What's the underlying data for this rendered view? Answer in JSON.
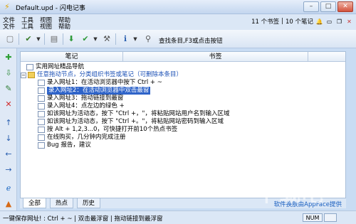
{
  "window": {
    "title": "Default.upd - 闪电记事",
    "minimize": "–",
    "maximize": "□",
    "close": "✕"
  },
  "menu": {
    "row1": [
      "文件",
      "工具",
      "视图",
      "帮助"
    ],
    "row2": [
      "文件",
      "工具",
      "视图",
      "帮助"
    ],
    "bookmark_count": "11 个书签",
    "hotspot_label": "10 个笔记"
  },
  "toolbar": {
    "hint": "查找条目,F3或点击按钮"
  },
  "columns": {
    "notes": "笔记",
    "bookmarks": "书签"
  },
  "tree": {
    "item1": "实用网址精品导航",
    "folder": "任意拖动节点，分类组织书签或笔记（可删除本条目）",
    "children": [
      "录入网址1：在活动浏览器中按下 Ctrl + ~",
      "录入网址2：在活动浏览器中双击最窗",
      "录入网址3：拖动链接到最窗",
      "录入网址4：点左边的绿色 +",
      "如该网址为活动态，按下 \"Ctrl +，\"，将粘贴网站用户名到输入区域",
      "如该网址为活动态，按下 \"Ctrl +。\"，将粘贴网站密码到输入区域",
      "按 Alt + 1,2,3...0，可快捷打开前10个热点书签",
      "在线购买，几分钟内完成注册",
      "Bug 报告，建议"
    ]
  },
  "tabs": [
    "全部",
    "热点",
    "历史"
  ],
  "skin_link": "软件换肤由AppFace提供",
  "status": {
    "text": "一键保存网址! : Ctrl + ~ | 双击最浮窗 | 拖动链接到最浮窗",
    "num": "NUM"
  },
  "colors": {
    "selection": "#2f64c9",
    "link_blue": "#1a4fb5",
    "accent_bg": "#c9dcf3"
  }
}
